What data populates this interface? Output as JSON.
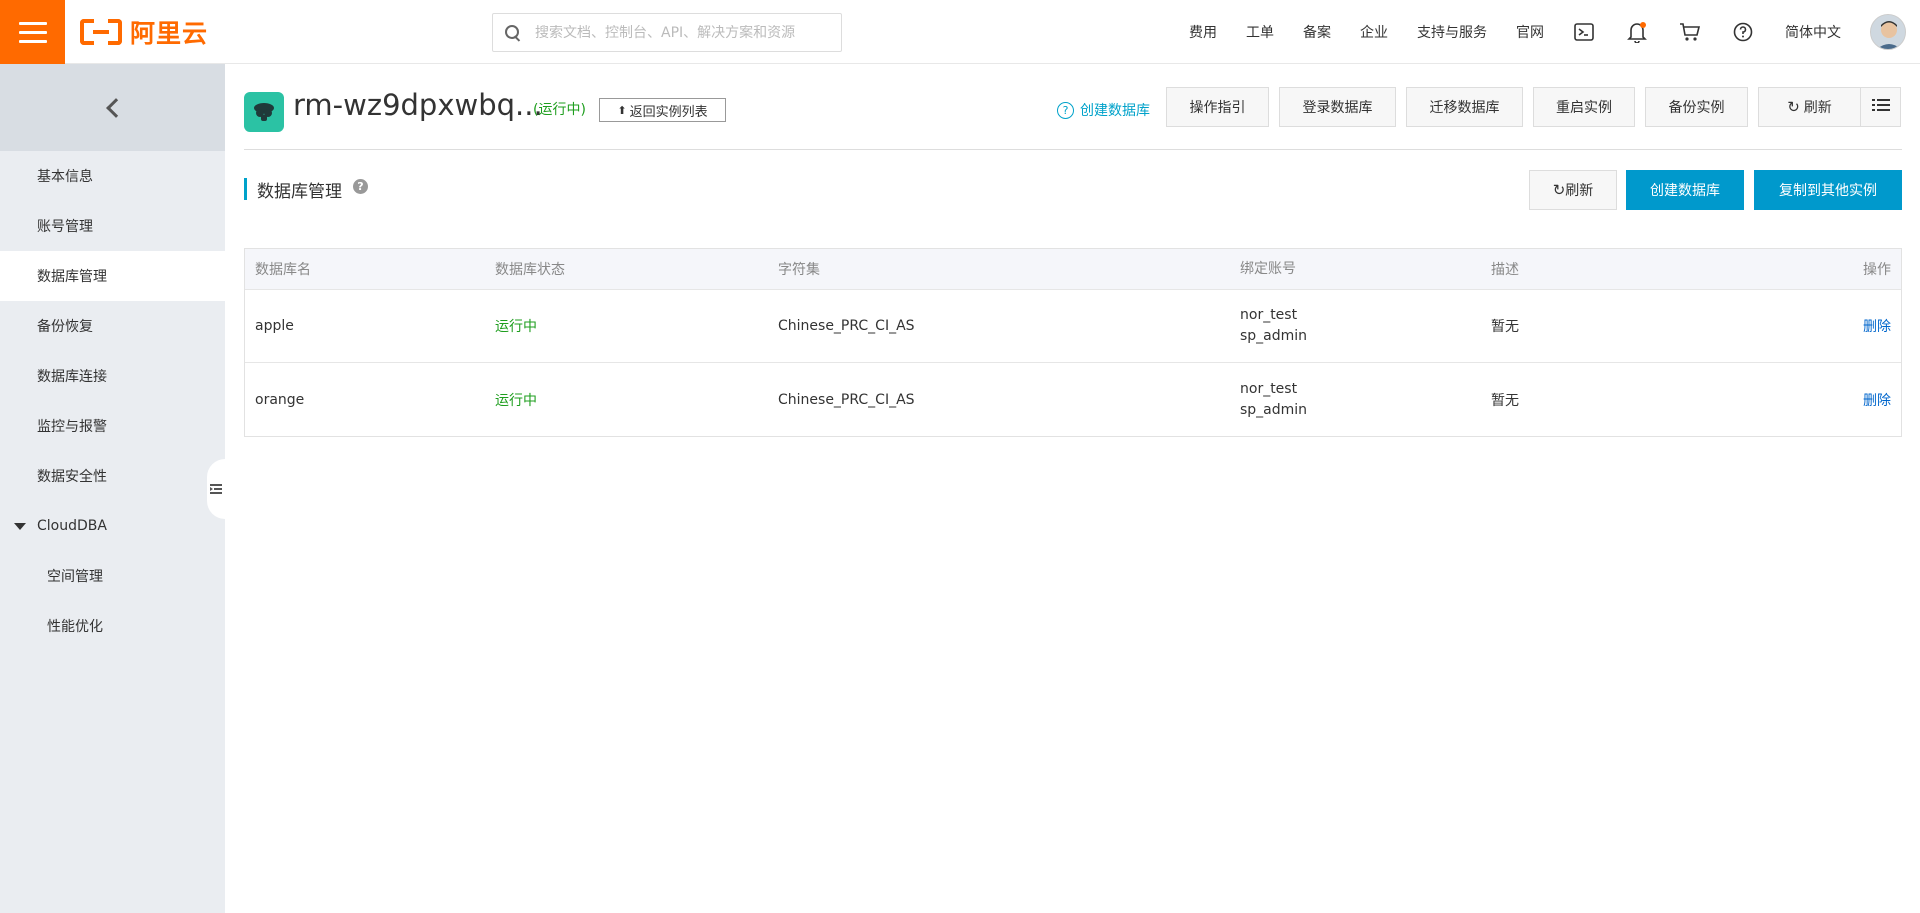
{
  "header": {
    "logo_text": "阿里云",
    "search_placeholder": "搜索文档、控制台、API、解决方案和资源",
    "nav": [
      "费用",
      "工单",
      "备案",
      "企业",
      "支持与服务",
      "官网"
    ],
    "language": "简体中文",
    "icons": [
      "terminal-icon",
      "bell-icon",
      "cart-icon",
      "help-icon"
    ],
    "accent_color": "#ff6a00"
  },
  "sidebar": {
    "items": [
      {
        "label": "基本信息",
        "active": false
      },
      {
        "label": "账号管理",
        "active": false
      },
      {
        "label": "数据库管理",
        "active": true
      },
      {
        "label": "备份恢复",
        "active": false
      },
      {
        "label": "数据库连接",
        "active": false
      },
      {
        "label": "监控与报警",
        "active": false
      },
      {
        "label": "数据安全性",
        "active": false
      }
    ],
    "group": {
      "label": "CloudDBA",
      "children": [
        "空间管理",
        "性能优化"
      ]
    }
  },
  "instance": {
    "title": "rm-wz9dpxwbq...",
    "status": "(运行中)",
    "back_label": "返回实例列表",
    "create_link": "创建数据库",
    "actions": [
      "操作指引",
      "登录数据库",
      "迁移数据库",
      "重启实例",
      "备份实例",
      "刷新"
    ]
  },
  "section": {
    "title": "数据库管理",
    "refresh_label": "刷新",
    "create_label": "创建数据库",
    "copy_label": "复制到其他实例"
  },
  "table": {
    "columns": [
      "数据库名",
      "数据库状态",
      "字符集",
      "绑定账号",
      "描述",
      "操作"
    ],
    "rows": [
      {
        "name": "apple",
        "status": "运行中",
        "charset": "Chinese_PRC_CI_AS",
        "accounts": [
          "nor_test",
          "sp_admin"
        ],
        "desc": "暂无",
        "action": "删除"
      },
      {
        "name": "orange",
        "status": "运行中",
        "charset": "Chinese_PRC_CI_AS",
        "accounts": [
          "nor_test",
          "sp_admin"
        ],
        "desc": "暂无",
        "action": "删除"
      }
    ]
  },
  "colors": {
    "primary_button": "#0099cc",
    "status_running": "#1e9e1e",
    "link": "#0066cc"
  }
}
